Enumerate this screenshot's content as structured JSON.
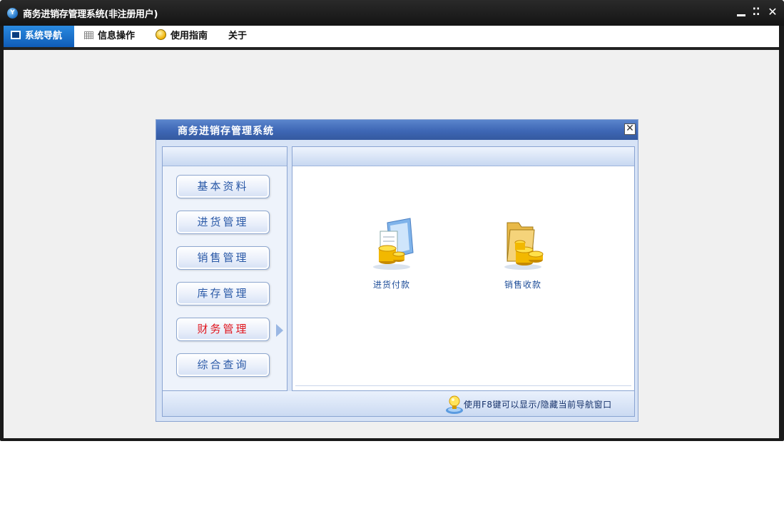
{
  "window": {
    "logo_letter": "Y",
    "title": "商务进销存管理系统(非注册用户)",
    "controls": {
      "minimize": "",
      "restore": "⁚⁚",
      "close": "✕"
    }
  },
  "menubar": {
    "tabs": [
      {
        "label": "系统导航",
        "icon": "monitor-icon",
        "active": true
      },
      {
        "label": "信息操作",
        "icon": "grid-icon",
        "active": false
      },
      {
        "label": "使用指南",
        "icon": "bulb-icon",
        "active": false
      },
      {
        "label": "关于",
        "icon": "",
        "active": false
      }
    ]
  },
  "dialog": {
    "title": "商务进销存管理系统",
    "close_glyph": "✕",
    "nav_buttons": [
      {
        "label": "基本资料",
        "active": false
      },
      {
        "label": "进货管理",
        "active": false
      },
      {
        "label": "销售管理",
        "active": false
      },
      {
        "label": "库存管理",
        "active": false
      },
      {
        "label": "财务管理",
        "active": true
      },
      {
        "label": "综合查询",
        "active": false
      }
    ],
    "features": [
      {
        "label": "进货付款",
        "icon": "purchase-payment-icon"
      },
      {
        "label": "销售收款",
        "icon": "sales-receipt-icon"
      }
    ],
    "status_hint": "使用F8键可以显示/隐藏当前导航窗口",
    "status_icon": "lightbulb-hint-icon"
  },
  "colors": {
    "title_bar": "#1a1a1a",
    "active_tab": "#0f5cb8",
    "dialog_title": "#3e67b5",
    "nav_text": "#2a59a7",
    "nav_active_text": "#e0161e",
    "feature_text": "#1e4d98"
  }
}
